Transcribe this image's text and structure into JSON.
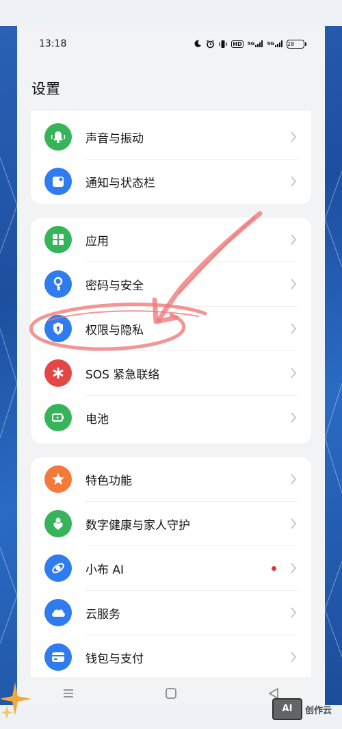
{
  "status_bar": {
    "time": "13:18",
    "icons": [
      "moon-icon",
      "alarm-icon",
      "vibrate-icon",
      "hd-icon",
      "5g-signal-icon",
      "5g-signal-icon",
      "battery-icon"
    ],
    "hd": "HD",
    "net1": "5G",
    "net2": "5G",
    "battery": "28"
  },
  "page": {
    "title": "设置"
  },
  "groups": [
    {
      "items": [
        {
          "label": "声音与振动",
          "icon": "bell-icon",
          "color": "#35b45a"
        },
        {
          "label": "通知与状态栏",
          "icon": "notification-icon",
          "color": "#2f7cf0"
        }
      ]
    },
    {
      "items": [
        {
          "label": "应用",
          "icon": "apps-grid-icon",
          "color": "#35b45a"
        },
        {
          "label": "密码与安全",
          "icon": "key-icon",
          "color": "#2f7cf0"
        },
        {
          "label": "权限与隐私",
          "icon": "shield-lock-icon",
          "color": "#2f7cf0"
        },
        {
          "label": "SOS 紧急联络",
          "icon": "asterisk-icon",
          "color": "#e54545"
        },
        {
          "label": "电池",
          "icon": "battery-charge-icon",
          "color": "#35b45a"
        }
      ]
    },
    {
      "items": [
        {
          "label": "特色功能",
          "icon": "star-icon",
          "color": "#f47a3b"
        },
        {
          "label": "数字健康与家人守护",
          "icon": "heart-person-icon",
          "color": "#35b45a"
        },
        {
          "label": "小布 AI",
          "icon": "ai-orbit-icon",
          "color": "#2f7cf0",
          "badge_color": "#e0344a"
        },
        {
          "label": "云服务",
          "icon": "cloud-icon",
          "color": "#2f7cf0"
        },
        {
          "label": "钱包与支付",
          "icon": "wallet-icon",
          "color": "#2f7cf0"
        }
      ]
    }
  ],
  "nav": [
    "menu-icon",
    "home-square-icon",
    "back-triangle-icon"
  ],
  "watermark": {
    "logo": "AI",
    "text": "创作云"
  },
  "colors": {
    "annotation": "#f07b7b",
    "background": "#1f55a8",
    "page": "#f2f3f5"
  }
}
